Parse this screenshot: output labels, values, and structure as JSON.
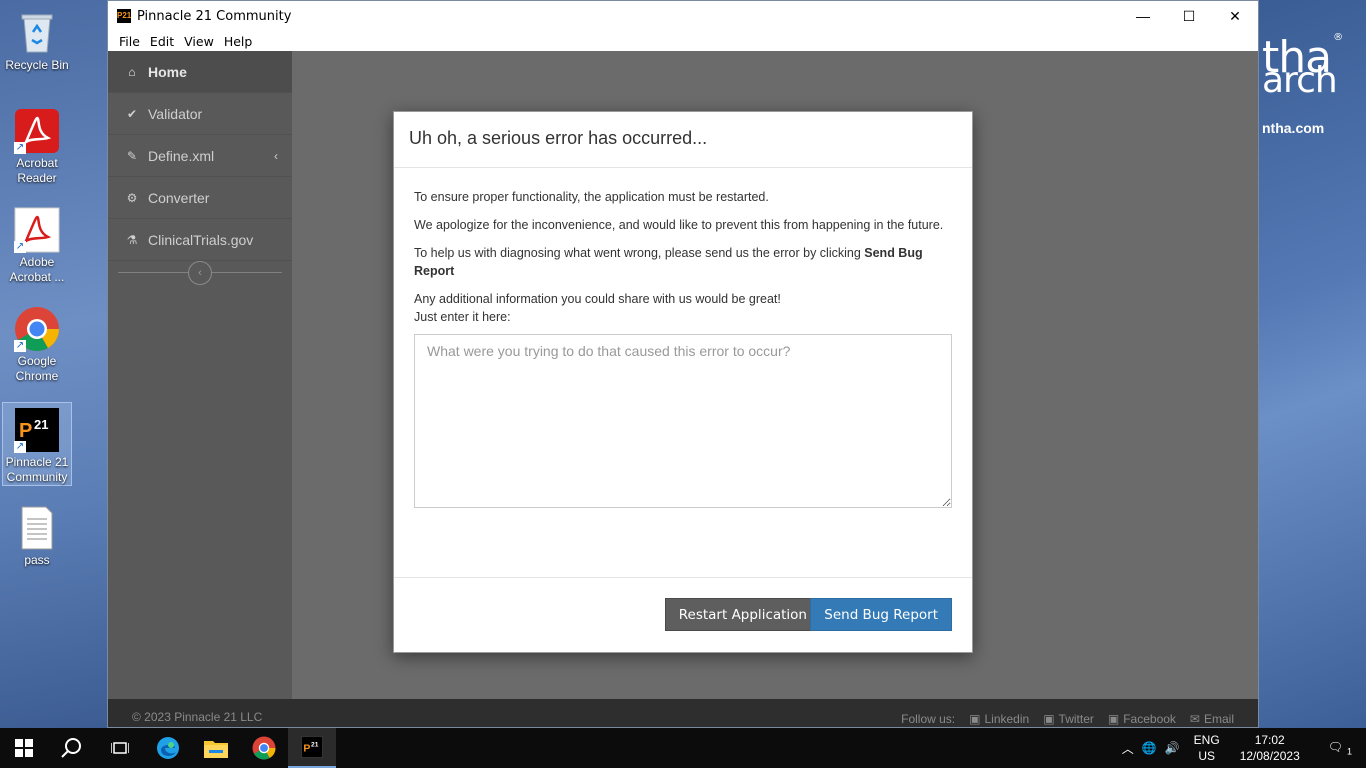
{
  "desktop": {
    "icons": [
      {
        "label": "Recycle Bin"
      },
      {
        "label": "Acrobat Reader"
      },
      {
        "label": "Adobe Acrobat ..."
      },
      {
        "label": "Google Chrome"
      },
      {
        "label": "Pinnacle 21 Community"
      },
      {
        "label": "pass"
      }
    ],
    "wallpaper_text": {
      "brand": "tha",
      "tagline": "arch",
      "url": "ntha.com",
      "registered": "®"
    }
  },
  "window": {
    "title": "Pinnacle 21 Community",
    "logo_text": "P21",
    "controls": {
      "minimize": "—",
      "maximize": "☐",
      "close": "✕"
    }
  },
  "menu": {
    "file": "File",
    "edit": "Edit",
    "view": "View",
    "help": "Help"
  },
  "sidebar": {
    "items": [
      {
        "label": "Home",
        "icon": "home-icon"
      },
      {
        "label": "Validator",
        "icon": "check-icon"
      },
      {
        "label": "Define.xml",
        "icon": "pencil-icon"
      },
      {
        "label": "Converter",
        "icon": "gears-icon"
      },
      {
        "label": "ClinicalTrials.gov",
        "icon": "flask-icon"
      }
    ]
  },
  "dialog": {
    "title": "Uh oh, a serious error has occurred...",
    "p1": "To ensure proper functionality, the application must be restarted.",
    "p2": "We apologize for the inconvenience, and would like to prevent this from happening in the future.",
    "p3_prefix": "To help us with diagnosing what went wrong, please send us the error by clicking ",
    "p3_bold": "Send Bug Report",
    "p4_line1": "Any additional information you could share with us would be great!",
    "p4_line2": "Just enter it here:",
    "textarea_placeholder": "What were you trying to do that caused this error to occur?",
    "textarea_value": "",
    "restart_label": "Restart Application",
    "send_label": "Send Bug Report"
  },
  "footer": {
    "copyright": "© 2023 Pinnacle 21 LLC",
    "follow": "Follow us:",
    "linkedin": "Linkedin",
    "twitter": "Twitter",
    "facebook": "Facebook",
    "email": "Email"
  },
  "taskbar": {
    "lang1": "ENG",
    "lang2": "US",
    "time": "17:02",
    "date": "12/08/2023",
    "notifications": "1"
  },
  "colors": {
    "primary_button": "#337ab7",
    "secondary_button": "#5e5e5e",
    "sidebar": "#595959",
    "footer": "#2e2e2e"
  }
}
